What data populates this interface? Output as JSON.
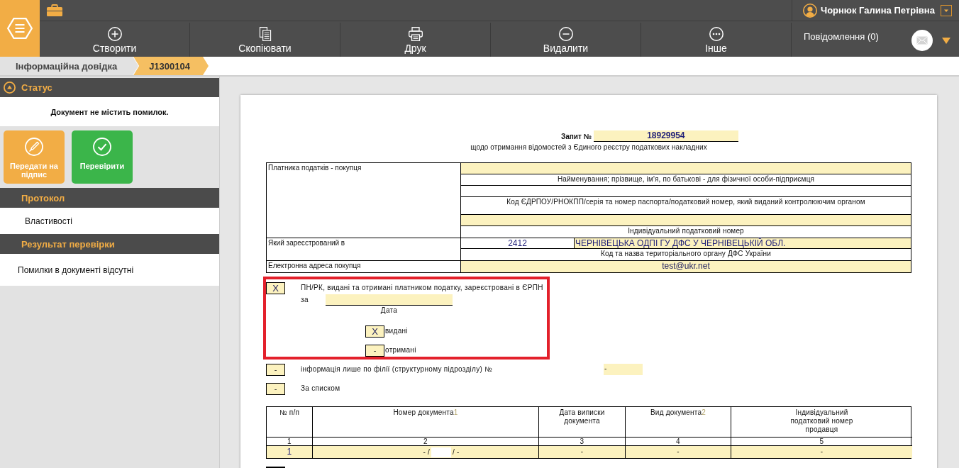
{
  "header": {
    "user_name": "Чорнюк Галина Петрівна"
  },
  "toolbar": [
    {
      "label": "Створити",
      "kind": "create"
    },
    {
      "label": "Скопіювати",
      "kind": "copy"
    },
    {
      "label": "Друк",
      "kind": "print"
    },
    {
      "label": "Видалити",
      "kind": "delete"
    },
    {
      "label": "Інше",
      "kind": "more"
    }
  ],
  "notifications": {
    "label": "Повідомлення (0)"
  },
  "breadcrumbs": [
    {
      "label": "Інформаційна довідка",
      "selected": false
    },
    {
      "label": "J1300104",
      "selected": true
    }
  ],
  "sidebar": {
    "status": {
      "title": "Статус",
      "message": "Документ не містить помилок."
    },
    "actions": [
      {
        "label": "Передати на підпис",
        "kind": "sign"
      },
      {
        "label": "Перевірити",
        "kind": "check"
      }
    ],
    "sections": [
      {
        "title": "Протокол",
        "items": [
          {
            "text": "Властивості",
            "kind": "link"
          }
        ]
      },
      {
        "title": "Результат перевірки",
        "items": [
          {
            "text": "Помилки в документі відсутні",
            "kind": "message"
          }
        ]
      }
    ]
  },
  "document": {
    "request": {
      "label": "Запит №",
      "number": "18929954",
      "subtitle": "щодо отримання відомостей з Єдиного реєстру податкових накладних"
    },
    "buyer": {
      "label": "Платника податків - покупця",
      "rows": [
        {
          "kind": "input"
        },
        {
          "kind": "caption",
          "text": "Найменування; прізвище, ім'я, по батькові - для фізичної особи-підприємця"
        },
        {
          "kind": "blank"
        },
        {
          "kind": "caption",
          "text": "Код ЄДРПОУ/РНОКПП/серія та номер паспорта/податковий номер, який виданий контролюючим органом"
        },
        {
          "kind": "input"
        },
        {
          "kind": "caption",
          "text": "Індивідуальний податковий номер"
        }
      ]
    },
    "registration": {
      "label": "Який зареєстрований в",
      "code": "2412",
      "office": "ЧЕРНІВЕЦЬКА ОДПІ ГУ ДФС У ЧЕРНІВЕЦЬКІЙ ОБЛ.",
      "caption": "Код та назва територіального органу ДФС України"
    },
    "email": {
      "label": "Електронна адреса покупця",
      "value": "test@ukr.net"
    },
    "erpn_option": {
      "highlighted": true,
      "checked": true,
      "mark": "X",
      "text": "ПН/РК, видані та отримані платником податку, зареєстровані в ЄРПН",
      "period_label": "за",
      "date_caption": "Дата",
      "sub_options": [
        {
          "checked": true,
          "mark": "X",
          "label": "видані"
        },
        {
          "checked": false,
          "mark": "-",
          "label": "отримані"
        }
      ]
    },
    "branch_option": {
      "checked": false,
      "mark": "-",
      "text": "інформація лише по філії (структурному підрозділу) №",
      "number": "-"
    },
    "list_option": {
      "checked": false,
      "mark": "-",
      "text": "За списком"
    },
    "documents_table": {
      "columns": [
        {
          "label": "№ п/п"
        },
        {
          "label": "Номер документа",
          "footnote": "1"
        },
        {
          "label": "Дата виписки документа"
        },
        {
          "label": "Вид документа",
          "footnote": "2"
        },
        {
          "label": "Індивідуальний податковий номер продавця"
        }
      ],
      "column_numbers": [
        "1",
        "2",
        "3",
        "4",
        "5"
      ],
      "rows": [
        {
          "index": "1",
          "number_start": "- /",
          "number_end": "/ -",
          "date": "-",
          "type": "-",
          "seller_tax_number": "-"
        }
      ]
    }
  }
}
